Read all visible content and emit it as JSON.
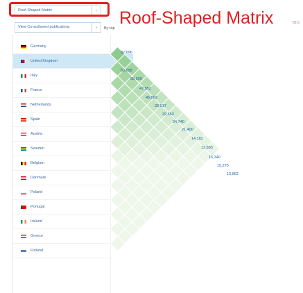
{
  "toolbar": {
    "view_select": "Roof-Shaped Matrix",
    "view_arrow": "⌄",
    "filter_select": "View Co-authored publications",
    "filter_arrow": "⌄",
    "sort_label": "By top"
  },
  "annotation": {
    "title": "Roof-Shaped Matrix",
    "title_tail": "82,6",
    "color": "#e02020"
  },
  "countries": [
    {
      "name": "Germany",
      "flag": "de-flag"
    },
    {
      "name": "United Kingdom",
      "flag": "uk-flag",
      "selected": true
    },
    {
      "name": "Italy",
      "flag": "it-flag"
    },
    {
      "name": "France",
      "flag": "fr-flag"
    },
    {
      "name": "Netherlands",
      "flag": "nl-flag"
    },
    {
      "name": "Spain",
      "flag": "es-flag"
    },
    {
      "name": "Austria",
      "flag": "at-flag"
    },
    {
      "name": "Sweden",
      "flag": "se-flag"
    },
    {
      "name": "Belgium",
      "flag": "be-flag"
    },
    {
      "name": "Denmark",
      "flag": "dk-flag"
    },
    {
      "name": "Poland",
      "flag": "pl-flag"
    },
    {
      "name": "Portugal",
      "flag": "pt-flag"
    },
    {
      "name": "Ireland",
      "flag": "ie-flag"
    },
    {
      "name": "Greece",
      "flag": "gr-flag"
    },
    {
      "name": "Finland",
      "flag": "fi-flag"
    }
  ],
  "diagonal_values": [
    "82,696",
    "59,658",
    "58,559",
    "47,852",
    "46,062",
    "33,517",
    "29,563",
    "24,740",
    "21,400",
    "14,182",
    "13,883",
    "16,340",
    "15,275",
    "13,962"
  ],
  "colors": {
    "highlight_row": "#cfe8f6",
    "cell_strong": "#7cc47c",
    "cell_weak": "#eef7ea",
    "value_text": "#1e5fa6"
  }
}
